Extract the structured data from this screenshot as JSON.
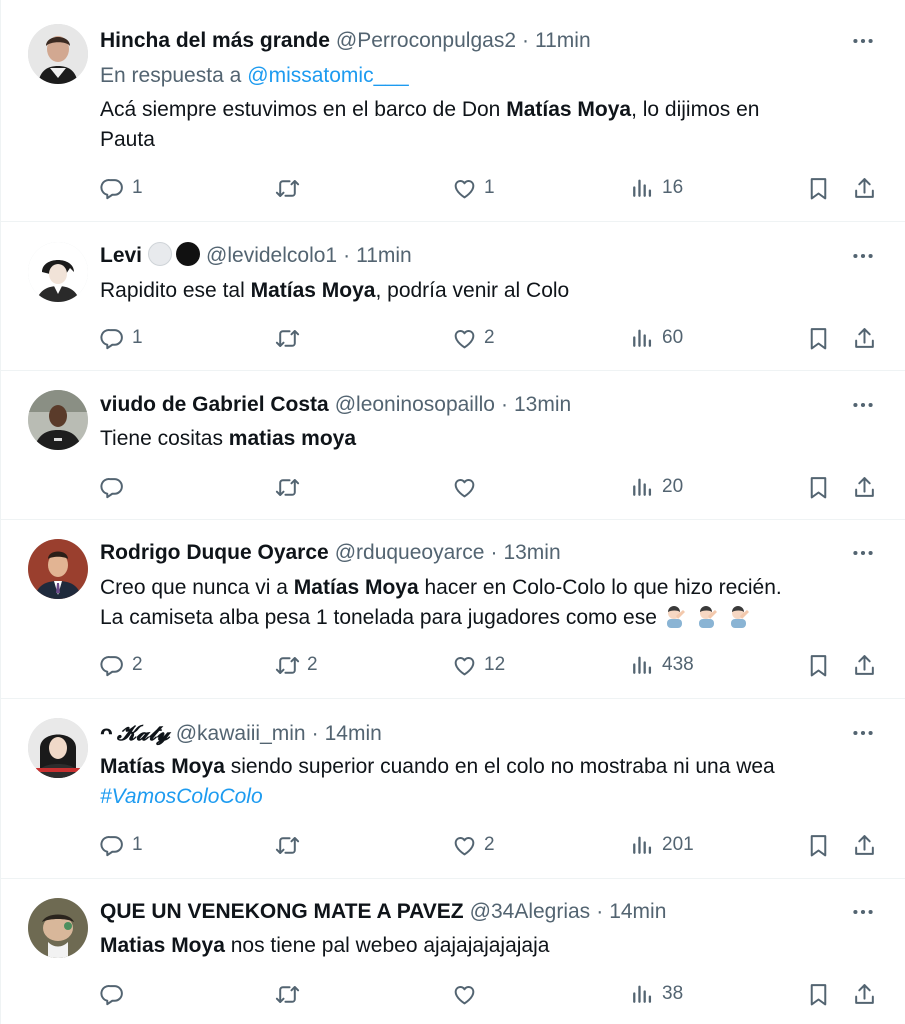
{
  "icons": {
    "reply": "reply-icon",
    "retweet": "retweet-icon",
    "like": "heart-icon",
    "views": "views-icon",
    "bookmark": "bookmark-icon",
    "share": "share-icon",
    "more": "more-icon"
  },
  "colors": {
    "link": "#1d9bf0",
    "muted": "#536471",
    "text": "#0f1419",
    "border": "#eff3f4"
  },
  "tweets": [
    {
      "name": "Hincha del más grande",
      "handle": "@Perroconpulgas2",
      "sep": "·",
      "time": "11min",
      "reply_label": "En respuesta a",
      "reply_to": "@missatomic___",
      "text_pre": "Acá siempre estuvimos en el barco de Don ",
      "text_bold": "Matías Moya",
      "text_post": ", lo dijimos en",
      "text_line2": "Pauta",
      "replies": "1",
      "retweets": "",
      "likes": "1",
      "views": "16"
    },
    {
      "name": "Levi",
      "handle": "@levidelcolo1",
      "sep": "·",
      "time": "11min",
      "text_pre": "Rapidito ese tal ",
      "text_bold": "Matías Moya",
      "text_post": ", podría venir al Colo",
      "replies": "1",
      "retweets": "",
      "likes": "2",
      "views": "60"
    },
    {
      "name": "viudo de Gabriel Costa",
      "handle": "@leoninosopaillo",
      "sep": "·",
      "time": "13min",
      "text_pre": "Tiene cositas ",
      "text_bold": "matias moya",
      "text_post": "",
      "replies": "",
      "retweets": "",
      "likes": "",
      "views": "20"
    },
    {
      "name": "Rodrigo Duque Oyarce",
      "handle": "@rduqueoyarce",
      "sep": "·",
      "time": "13min",
      "text_pre": "Creo que nunca vi a ",
      "text_bold": "Matías Moya",
      "text_post": " hacer en Colo-Colo lo que hizo recién.",
      "text_line2": "La camiseta alba pesa 1 tonelada para jugadores como ese",
      "replies": "2",
      "retweets": "2",
      "likes": "12",
      "views": "438"
    },
    {
      "name": "𝓚𝓪𝓽𝔂",
      "name_prefix": "ᴖ",
      "handle": "@kawaiii_min",
      "sep": "·",
      "time": "14min",
      "text_pre": "",
      "text_bold": "Matías Moya",
      "text_post": " siendo superior cuando en el colo no mostraba ni una wea",
      "hashtag": "#VamosColoColo",
      "replies": "1",
      "retweets": "",
      "likes": "2",
      "views": "201"
    },
    {
      "name": "QUE UN VENEKONG MATE A PAVEZ",
      "handle": "@34Alegrias",
      "sep": "·",
      "time": "14min",
      "text_pre": "",
      "text_bold": "Matias Moya",
      "text_post": " nos tiene pal webeo ajajajajajajaja",
      "replies": "",
      "retweets": "",
      "likes": "",
      "views": "38"
    }
  ]
}
